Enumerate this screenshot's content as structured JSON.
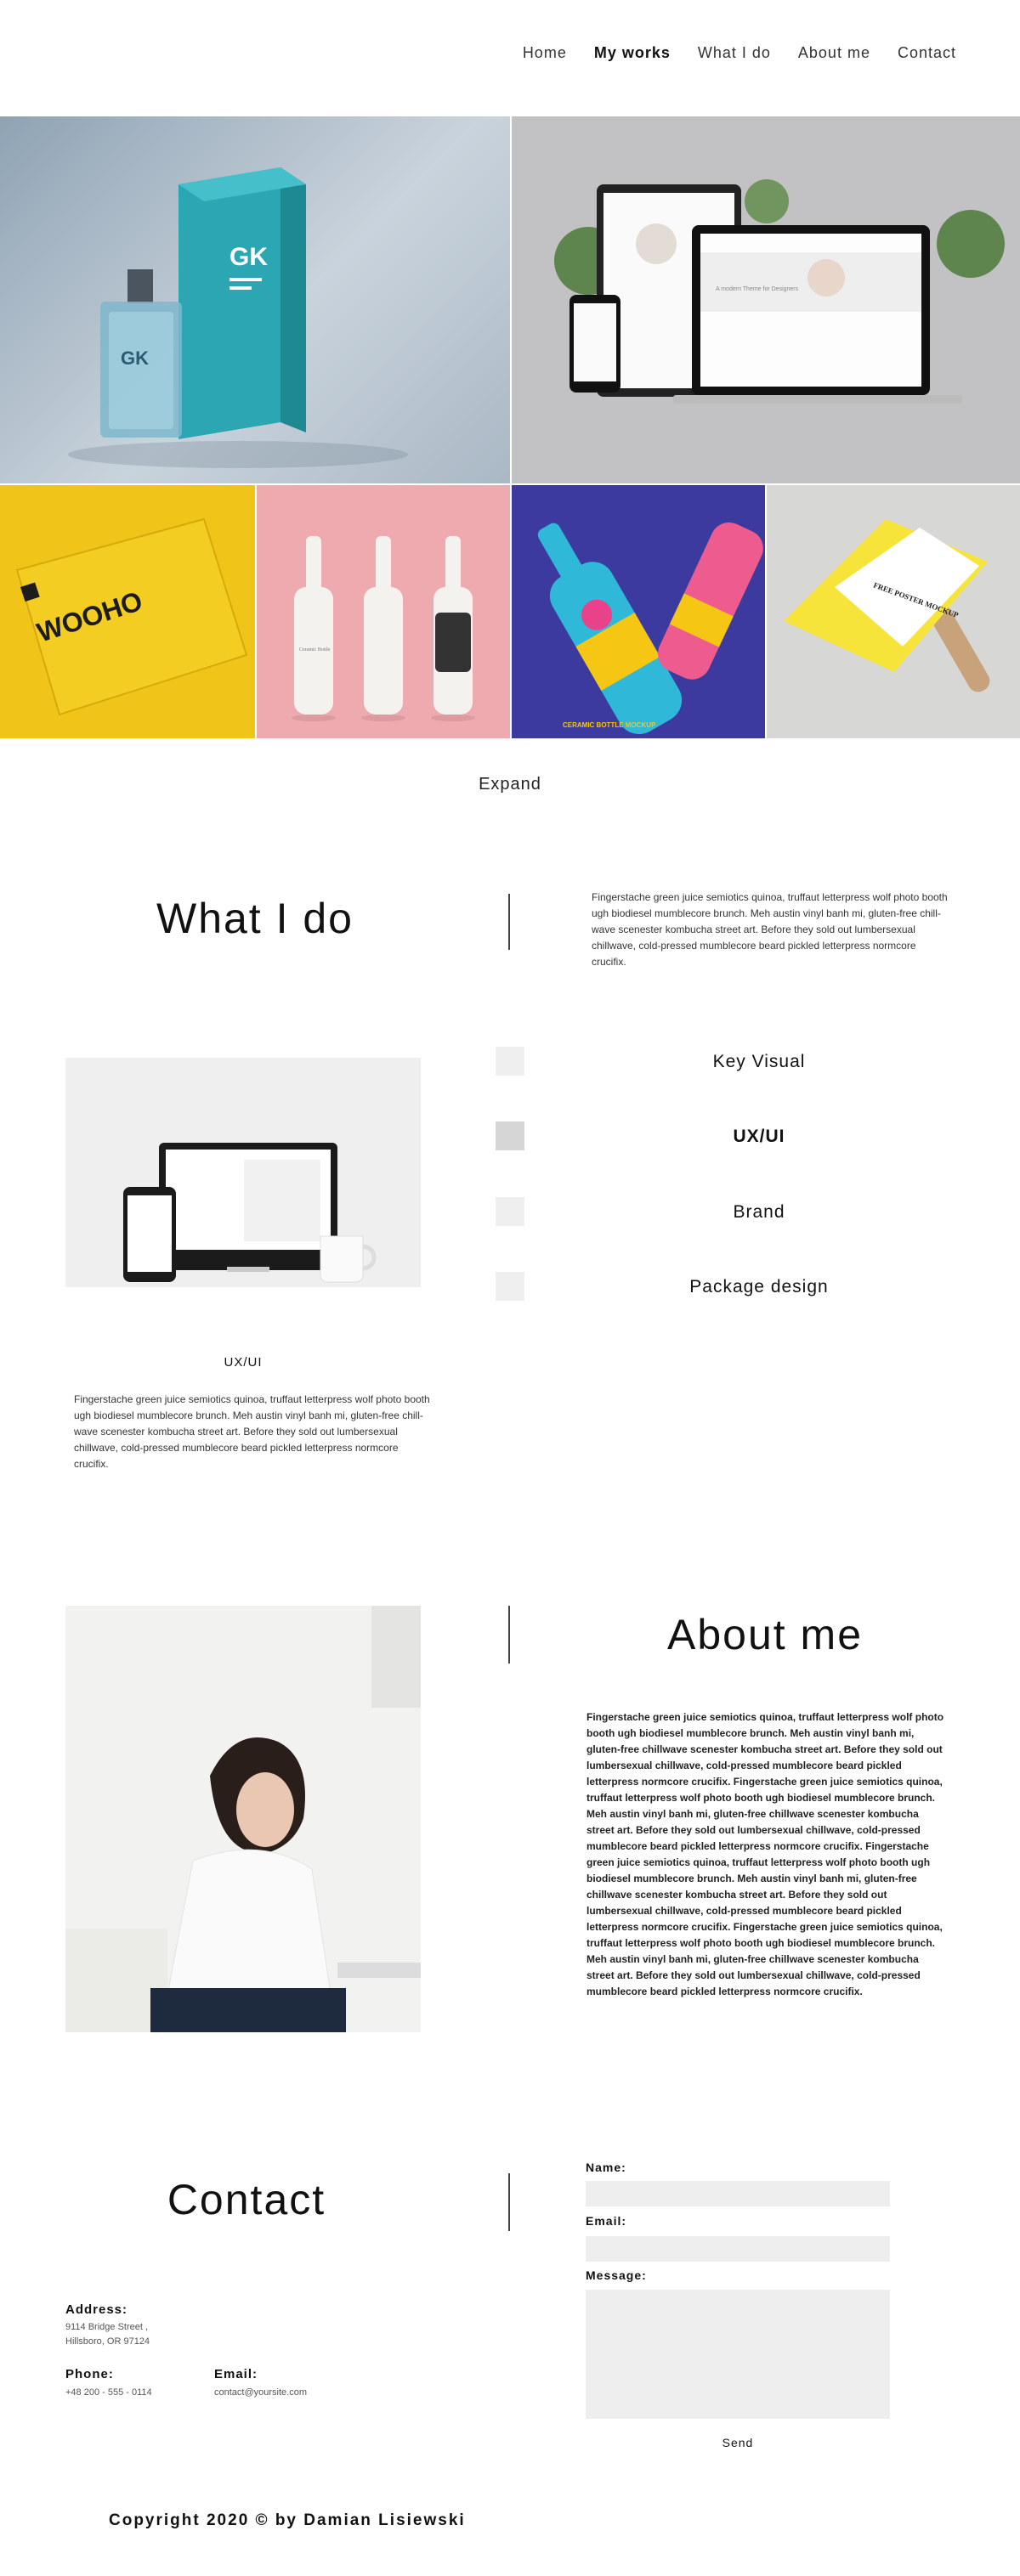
{
  "nav": {
    "items": [
      {
        "label": "Home"
      },
      {
        "label": "My works"
      },
      {
        "label": "What I do"
      },
      {
        "label": "About me"
      },
      {
        "label": "Contact"
      }
    ],
    "active": "My works"
  },
  "gallery": {
    "tiles": [
      {
        "logo": "GK"
      },
      {
        "hero_caption": "A modern Theme for Designers"
      },
      {
        "brand": "WOOHO"
      },
      {
        "label": "Ceramic Bottle"
      },
      {
        "label": "CERAMIC BOTTLE MOCKUP"
      },
      {
        "label": "FREE POSTER MOCKUP"
      }
    ],
    "expand_label": "Expand"
  },
  "what_i_do": {
    "title": "What I do",
    "text": "Fingerstache green juice semiotics quinoa, truffaut letterpress wolf photo booth ugh biodiesel mumblecore brunch. Meh austin vinyl banh mi, gluten-free chill-wave scenester kombucha street art. Before they sold out lumbersexual chillwave, cold-pressed mumblecore beard pickled letterpress normcore crucifix.",
    "preview_caption": "UX/UI",
    "preview_text": "Fingerstache green juice semiotics quinoa, truffaut letterpress wolf photo booth ugh biodiesel mumblecore brunch. Meh austin vinyl banh mi, gluten-free chill-wave scenester kombucha street art. Before they sold out lumbersexual chillwave, cold-pressed mumblecore beard pickled letterpress normcore crucifix.",
    "services": [
      {
        "label": "Key Visual"
      },
      {
        "label": "UX/UI"
      },
      {
        "label": "Brand"
      },
      {
        "label": "Package design"
      }
    ],
    "selected": "UX/UI"
  },
  "about": {
    "title": "About me",
    "text": "Fingerstache green juice semiotics quinoa, truffaut letterpress wolf photo booth ugh biodiesel mumblecore brunch. Meh austin vinyl banh mi, gluten-free chillwave scenester kombucha street art. Before they sold out lumbersexual chillwave, cold-pressed mumblecore beard pickled letterpress normcore crucifix. Fingerstache green juice semiotics quinoa, truffaut letterpress wolf photo booth ugh biodiesel mumblecore brunch. Meh austin vinyl banh mi, gluten-free chillwave scenester kombucha street art. Before they sold out lumbersexual chillwave, cold-pressed mumblecore beard pickled letterpress normcore crucifix. Fingerstache green juice semiotics quinoa, truffaut letterpress wolf photo booth ugh biodiesel mumblecore brunch. Meh austin vinyl banh mi, gluten-free chillwave scenester kombucha street art. Before they sold out lumbersexual chillwave, cold-pressed mumblecore beard pickled letterpress normcore crucifix. Fingerstache green juice semiotics quinoa, truffaut letterpress wolf photo booth ugh biodiesel mumblecore brunch. Meh austin vinyl banh mi, gluten-free chillwave scenester kombucha street art. Before they sold out lumbersexual chillwave, cold-pressed mumblecore beard pickled letterpress normcore crucifix."
  },
  "contact": {
    "title": "Contact",
    "address_label": "Address:",
    "address_line1": "9114 Bridge Street ,",
    "address_line2": "Hillsboro, OR 97124",
    "phone_label": "Phone:",
    "phone": "+48 200 - 555 - 0114",
    "email_label": "Email:",
    "email": "contact@yoursite.com",
    "form": {
      "name_label": "Name:",
      "email_label": "Email:",
      "message_label": "Message:",
      "send_label": "Send"
    }
  },
  "footer": {
    "copyright": "Copyright 2020 © by Damian Lisiewski"
  },
  "colors": {
    "accent_yellow": "#f0c419",
    "accent_teal": "#2fa6b0",
    "pink": "#eeaaae",
    "indigo": "#3c3a9e",
    "field_bg": "#eeeeee"
  }
}
